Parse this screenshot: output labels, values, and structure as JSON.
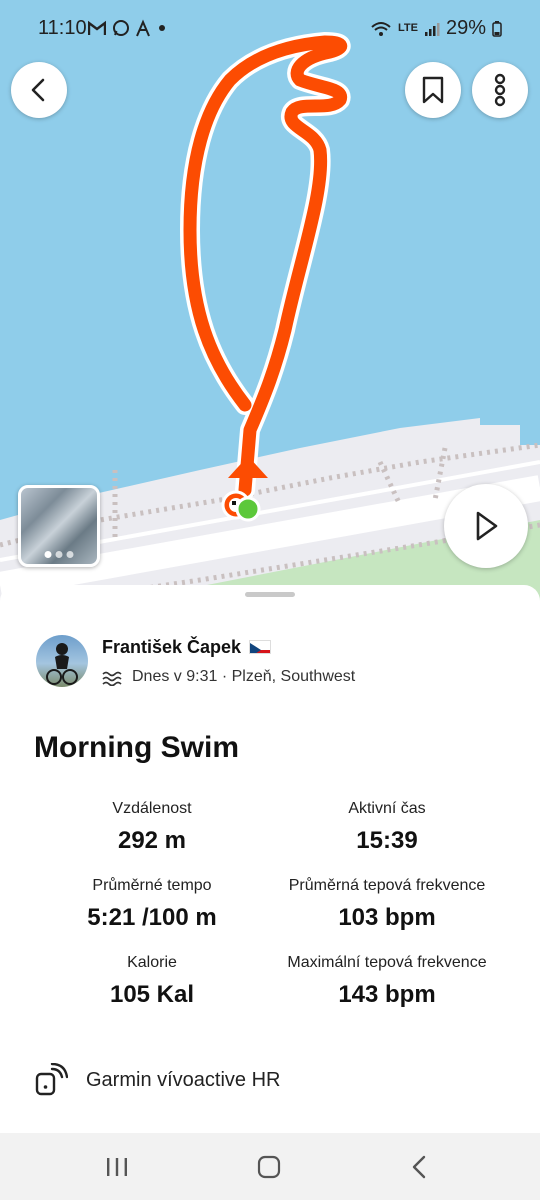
{
  "status_bar": {
    "time": "11:10",
    "battery": "29%",
    "network": "LTE"
  },
  "map": {
    "colors": {
      "water": "#8fcdea",
      "land": "#ececf1",
      "route": "#fc4c02",
      "start": "#5cc83a",
      "park": "#c6e6c0"
    }
  },
  "header": {
    "back_icon": "chevron-left-icon",
    "bookmark_icon": "bookmark-icon",
    "more_icon": "more-vertical-icon"
  },
  "athlete": {
    "name": "František Čapek",
    "meta": "Dnes v 9:31 · Plzeň, Southwest",
    "sport_icon": "swim-icon"
  },
  "activity": {
    "title": "Morning Swim",
    "stats": [
      {
        "label": "Vzdálenost",
        "value": "292 m"
      },
      {
        "label": "Aktivní čas",
        "value": "15:39"
      },
      {
        "label": "Průměrné tempo",
        "value": "5:21 /100 m"
      },
      {
        "label": "Průměrná tepová frekvence",
        "value": "103 bpm"
      },
      {
        "label": "Kalorie",
        "value": "105 Kal"
      },
      {
        "label": "Maximální tepová frekvence",
        "value": "143 bpm"
      }
    ]
  },
  "device": {
    "name": "Garmin vívoactive HR"
  },
  "photos": {
    "count": 3,
    "active": 0
  }
}
